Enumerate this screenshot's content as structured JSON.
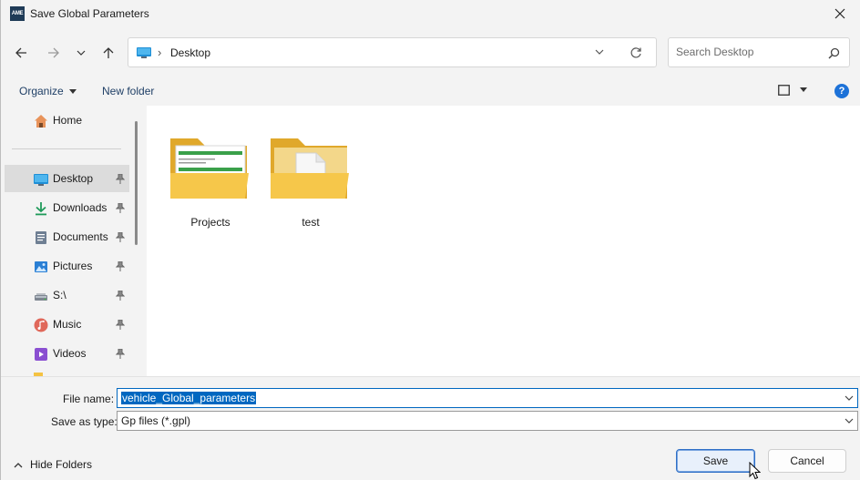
{
  "window": {
    "title": "Save Global Parameters",
    "app_icon_text": "AME"
  },
  "nav": {
    "back": "back-arrow-icon",
    "forward": "forward-arrow-icon",
    "recent": "chevron-down-icon",
    "up": "up-arrow-icon",
    "path": "Desktop",
    "search_placeholder": "Search Desktop"
  },
  "commands": {
    "organize": "Organize",
    "new_folder": "New folder"
  },
  "sidebar": {
    "items": [
      {
        "label": "Home",
        "icon": "home-icon",
        "pinned": false
      },
      {
        "label": "Desktop",
        "icon": "desktop-icon",
        "pinned": true,
        "selected": true
      },
      {
        "label": "Downloads",
        "icon": "download-icon",
        "pinned": true
      },
      {
        "label": "Documents",
        "icon": "documents-icon",
        "pinned": true
      },
      {
        "label": "Pictures",
        "icon": "pictures-icon",
        "pinned": true
      },
      {
        "label": "S:\\",
        "icon": "drive-icon",
        "pinned": true
      },
      {
        "label": "Music",
        "icon": "music-icon",
        "pinned": true
      },
      {
        "label": "Videos",
        "icon": "videos-icon",
        "pinned": true
      }
    ]
  },
  "files": [
    {
      "name": "Projects",
      "icon": "folder-with-documents-icon"
    },
    {
      "name": "test",
      "icon": "folder-with-file-icon"
    }
  ],
  "form": {
    "file_name_label": "File name:",
    "file_name_value": "vehicle_Global_parameters",
    "save_type_label": "Save as type:",
    "save_type_value": "Gp files (*.gpl)"
  },
  "footer": {
    "hide_folders": "Hide Folders",
    "save": "Save",
    "cancel": "Cancel"
  },
  "colors": {
    "accent": "#0067c0",
    "folder": "#f4c242",
    "help": "#1d72d8"
  }
}
